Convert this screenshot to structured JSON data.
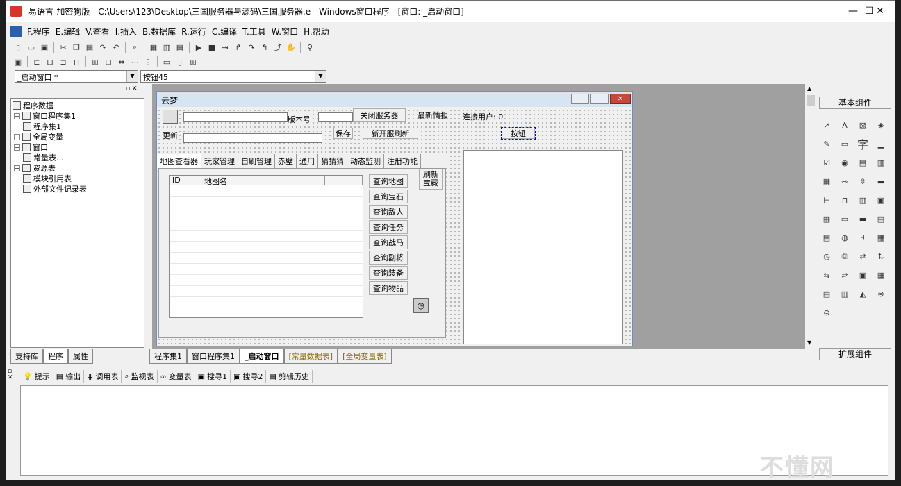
{
  "window": {
    "title": "易语言-加密狗版 - C:\\Users\\123\\Desktop\\三国服务器与源码\\三国服务器.e - Windows窗口程序 - [窗口: _启动窗口]",
    "min": "—",
    "max": "☐",
    "close": "✕"
  },
  "menu": [
    "F.程序",
    "E.编辑",
    "V.查看",
    "I.插入",
    "B.数据库",
    "R.运行",
    "C.编译",
    "T.工具",
    "W.窗口",
    "H.帮助"
  ],
  "combos": {
    "left": "_启动窗口 *",
    "right": "按钮45"
  },
  "tree": {
    "root": "程序数据",
    "items": [
      "窗口程序集1",
      "程序集1",
      "全局变量",
      "窗口",
      "常量表...",
      "资源表",
      "模块引用表",
      "外部文件记录表"
    ]
  },
  "left_tabs": [
    "支持库",
    "程序",
    "属性"
  ],
  "form": {
    "title": "云梦",
    "label_version": "版本号",
    "btn_close_server": "关闭服务器",
    "label_news": "最新情报",
    "label_users": "连接用户: 0",
    "label_update": "更新",
    "btn_save": "保存",
    "btn_new_server": "新开服刷新",
    "btn_button": "按钮",
    "tabs": [
      "地图查看器",
      "玩家管理",
      "自刷管理",
      "赤壁",
      "通用",
      "猜猜猜",
      "动态监测",
      "注册功能"
    ],
    "grid_headers": [
      "ID",
      "地图名"
    ],
    "query_buttons": [
      "查询地图",
      "查询宝石",
      "查询敌人",
      "查询任务",
      "查询战马",
      "查询副将",
      "查询装备",
      "查询物品"
    ],
    "refresh_btn_line1": "刷新",
    "refresh_btn_line2": "宝藏"
  },
  "doc_tabs": [
    "程序集1",
    "窗口程序集1",
    "_启动窗口",
    "[常量数据表]",
    "[全局变量表]"
  ],
  "right": {
    "header": "基本组件",
    "footer": "扩展组件"
  },
  "output_tabs": [
    "提示",
    "输出",
    "调用表",
    "监视表",
    "变量表",
    "搜寻1",
    "搜寻2",
    "剪辑历史"
  ],
  "watermark": "不懂网"
}
